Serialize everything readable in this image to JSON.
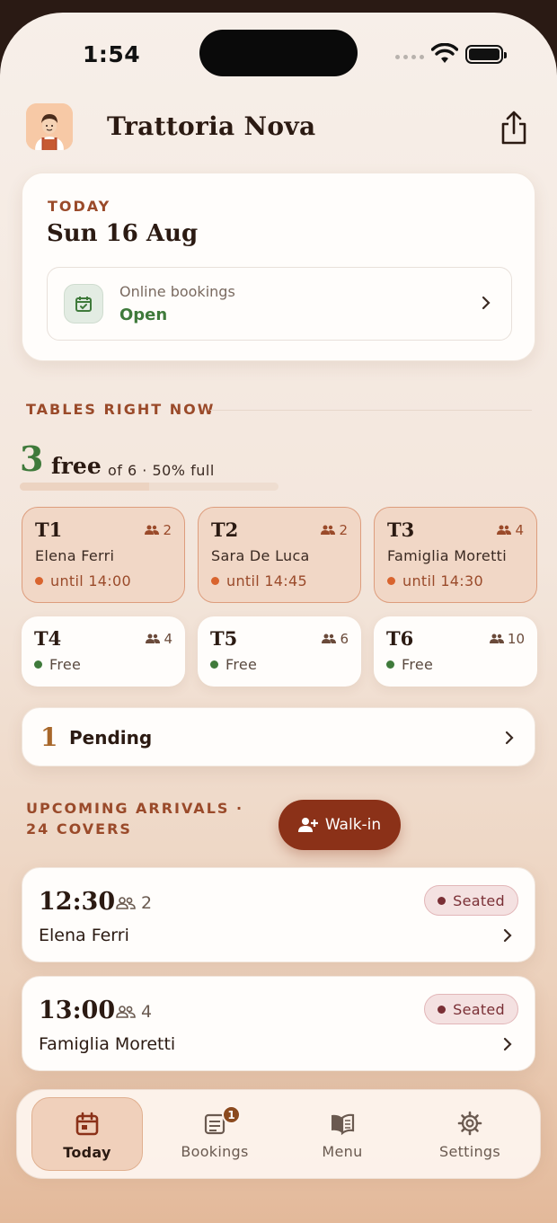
{
  "status_bar": {
    "time": "1:54"
  },
  "header": {
    "title": "Trattoria Nova"
  },
  "today": {
    "label": "TODAY",
    "date": "Sun 16 Aug",
    "online_bookings_label": "Online bookings",
    "online_bookings_status": "Open"
  },
  "tables_section": {
    "title": "TABLES RIGHT NOW",
    "free_count": "3",
    "free_word": "free",
    "meta": "of 6 · 50% full",
    "occupancy_fraction": 0.5
  },
  "tables": [
    {
      "name": "T1",
      "seats": "2",
      "guest": "Elena Ferri",
      "until": "until 14:00"
    },
    {
      "name": "T2",
      "seats": "2",
      "guest": "Sara De Luca",
      "until": "until 14:45"
    },
    {
      "name": "T3",
      "seats": "4",
      "guest": "Famiglia Moretti",
      "until": "until 14:30"
    },
    {
      "name": "T4",
      "seats": "4",
      "status": "Free"
    },
    {
      "name": "T5",
      "seats": "6",
      "status": "Free"
    },
    {
      "name": "T6",
      "seats": "10",
      "status": "Free"
    }
  ],
  "pending": {
    "count": "1",
    "label": "Pending"
  },
  "upcoming": {
    "title": "UPCOMING ARRIVALS · 24 COVERS",
    "walkin_label": "Walk-in",
    "arrivals": [
      {
        "time": "12:30",
        "party": "2",
        "name": "Elena Ferri",
        "status": "Seated"
      },
      {
        "time": "13:00",
        "party": "4",
        "name": "Famiglia Moretti",
        "status": "Seated"
      }
    ]
  },
  "tabbar": {
    "items": [
      {
        "label": "Today",
        "icon": "calendar-icon"
      },
      {
        "label": "Bookings",
        "icon": "bookings-icon",
        "badge": "1"
      },
      {
        "label": "Menu",
        "icon": "menu-book-icon"
      },
      {
        "label": "Settings",
        "icon": "gear-icon"
      }
    ]
  },
  "colors": {
    "accent": "#8b3118",
    "free_green": "#3f7a3b",
    "occupied_orange": "#d9642e",
    "seated_maroon": "#7a2f35"
  }
}
